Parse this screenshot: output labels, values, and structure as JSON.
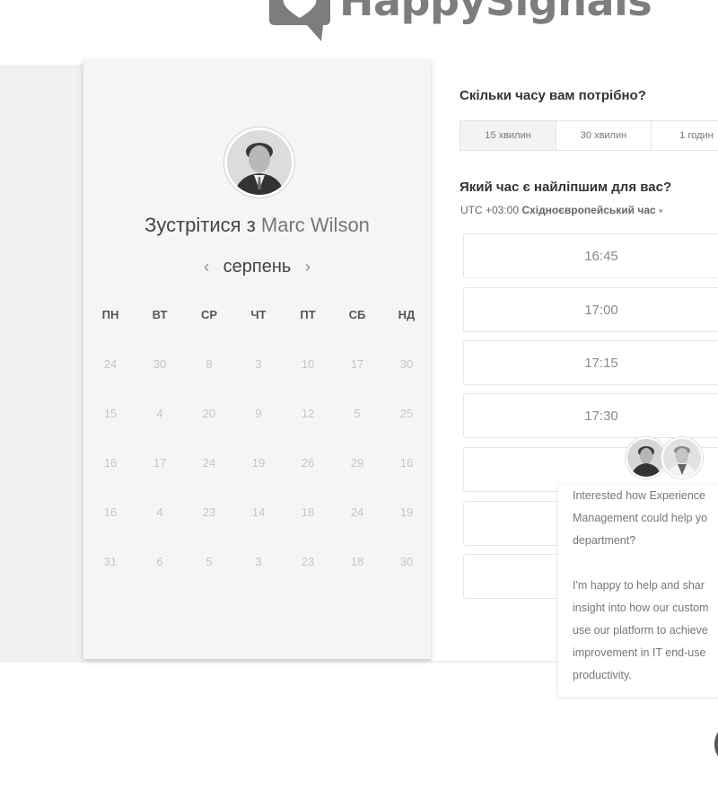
{
  "brand": {
    "name": "HappySignals"
  },
  "calendar": {
    "title_prefix": "Зустрітися з",
    "host_name": "Marc Wilson",
    "month": "серпень",
    "prev_arrow": "‹",
    "next_arrow": "›",
    "weekdays": [
      "ПН",
      "ВТ",
      "СР",
      "ЧТ",
      "ПТ",
      "СБ",
      "НД"
    ],
    "weeks": [
      [
        "24",
        "30",
        "8",
        "3",
        "10",
        "17",
        "30"
      ],
      [
        "15",
        "4",
        "20",
        "9",
        "12",
        "5",
        "25"
      ],
      [
        "16",
        "17",
        "24",
        "19",
        "26",
        "29",
        "16"
      ],
      [
        "16",
        "4",
        "23",
        "14",
        "18",
        "24",
        "19"
      ],
      [
        "31",
        "6",
        "5",
        "3",
        "23",
        "18",
        "30"
      ]
    ]
  },
  "duration": {
    "question": "Скільки часу вам потрібно?",
    "options": [
      "15 хвилин",
      "30 хвилин",
      "1 годин"
    ],
    "selected_index": 0
  },
  "time": {
    "question": "Який час є найліпшим для вас?",
    "timezone_offset": "UTC +03:00",
    "timezone_name": "Східноєвропейський час",
    "timezone_caret": "▾",
    "slots": [
      "16:45",
      "17:00",
      "17:15",
      "17:30",
      "",
      "",
      ""
    ]
  },
  "chat": {
    "lines": [
      "Interested how Experience",
      "Management could help yo",
      "department?",
      "",
      "I'm happy to help and shar",
      "insight into how our custom",
      "use our platform to achieve",
      "improvement in IT end-use",
      "productivity."
    ]
  },
  "icons": {
    "logo": "speech-bubble-heart-icon",
    "host_avatar": "user-avatar-icon",
    "chat_bubble": "chat-bubble-icon"
  }
}
